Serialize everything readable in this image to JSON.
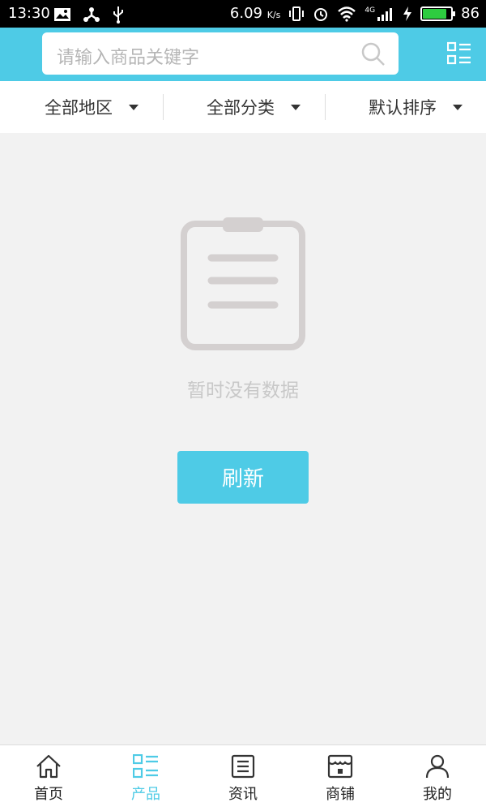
{
  "status_bar": {
    "time": "13:30",
    "speed": "6.09",
    "speed_unit": "K/s",
    "network": "4G",
    "battery": "86",
    "battery_level": 0.86
  },
  "search": {
    "placeholder": "请输入商品关键字"
  },
  "filters": [
    {
      "label": "全部地区"
    },
    {
      "label": "全部分类"
    },
    {
      "label": "默认排序"
    }
  ],
  "empty_state": {
    "message": "暂时没有数据",
    "refresh_label": "刷新"
  },
  "tabs": [
    {
      "label": "首页",
      "icon": "home-icon"
    },
    {
      "label": "产品",
      "icon": "grid-list-icon"
    },
    {
      "label": "资讯",
      "icon": "news-icon"
    },
    {
      "label": "商铺",
      "icon": "shop-icon"
    },
    {
      "label": "我的",
      "icon": "user-icon"
    }
  ],
  "active_tab": "产品",
  "colors": {
    "accent": "#4ecbe6",
    "background": "#f2f2f2",
    "placeholder": "#b5b5b5"
  }
}
